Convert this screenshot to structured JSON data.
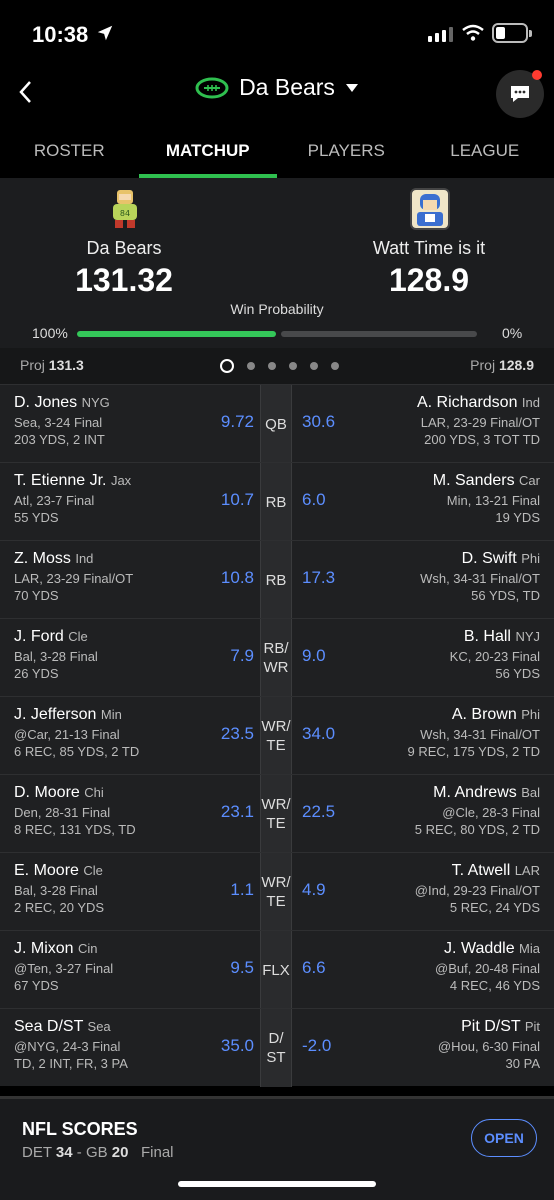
{
  "status": {
    "time": "10:38"
  },
  "header": {
    "title": "Da Bears"
  },
  "tabs": [
    {
      "label": "ROSTER"
    },
    {
      "label": "MATCHUP"
    },
    {
      "label": "PLAYERS"
    },
    {
      "label": "LEAGUE"
    }
  ],
  "matchup": {
    "left": {
      "name": "Da Bears",
      "score": "131.32",
      "win_pct": "100%",
      "proj": "131.3"
    },
    "right": {
      "name": "Watt Time is it",
      "score": "128.9",
      "win_pct": "0%",
      "proj": "128.9"
    },
    "win_label": "Win Probability",
    "win_fraction_left": 1.0,
    "proj_label": "Proj",
    "pager": {
      "pages": 6,
      "current": 0
    }
  },
  "rows": [
    {
      "pos": "QB",
      "l": {
        "name": "D. Jones",
        "team": "NYG",
        "game": "Sea, 3-24 Final",
        "stats": "203 YDS, 2 INT",
        "pts": "9.72"
      },
      "r": {
        "name": "A. Richardson",
        "team": "Ind",
        "game": "LAR, 23-29 Final/OT",
        "stats": "200 YDS, 3 TOT TD",
        "pts": "30.6"
      }
    },
    {
      "pos": "RB",
      "l": {
        "name": "T. Etienne Jr.",
        "team": "Jax",
        "game": "Atl, 23-7 Final",
        "stats": "55 YDS",
        "pts": "10.7"
      },
      "r": {
        "name": "M. Sanders",
        "team": "Car",
        "game": "Min, 13-21 Final",
        "stats": "19 YDS",
        "pts": "6.0"
      }
    },
    {
      "pos": "RB",
      "l": {
        "name": "Z. Moss",
        "team": "Ind",
        "game": "LAR, 23-29 Final/OT",
        "stats": "70 YDS",
        "pts": "10.8"
      },
      "r": {
        "name": "D. Swift",
        "team": "Phi",
        "game": "Wsh, 34-31 Final/OT",
        "stats": "56 YDS, TD",
        "pts": "17.3"
      }
    },
    {
      "pos": "RB/\nWR",
      "l": {
        "name": "J. Ford",
        "team": "Cle",
        "game": "Bal, 3-28 Final",
        "stats": "26 YDS",
        "pts": "7.9"
      },
      "r": {
        "name": "B. Hall",
        "team": "NYJ",
        "game": "KC, 20-23 Final",
        "stats": "56 YDS",
        "pts": "9.0"
      }
    },
    {
      "pos": "WR/\nTE",
      "l": {
        "name": "J. Jefferson",
        "team": "Min",
        "game": "@Car, 21-13 Final",
        "stats": "6 REC, 85 YDS, 2 TD",
        "pts": "23.5"
      },
      "r": {
        "name": "A. Brown",
        "team": "Phi",
        "game": "Wsh, 34-31 Final/OT",
        "stats": "9 REC, 175 YDS, 2 TD",
        "pts": "34.0"
      }
    },
    {
      "pos": "WR/\nTE",
      "l": {
        "name": "D. Moore",
        "team": "Chi",
        "game": "Den, 28-31 Final",
        "stats": "8 REC, 131 YDS, TD",
        "pts": "23.1"
      },
      "r": {
        "name": "M. Andrews",
        "team": "Bal",
        "game": "@Cle, 28-3 Final",
        "stats": "5 REC, 80 YDS, 2 TD",
        "pts": "22.5"
      }
    },
    {
      "pos": "WR/\nTE",
      "l": {
        "name": "E. Moore",
        "team": "Cle",
        "game": "Bal, 3-28 Final",
        "stats": "2 REC, 20 YDS",
        "pts": "1.1"
      },
      "r": {
        "name": "T. Atwell",
        "team": "LAR",
        "game": "@Ind, 29-23 Final/OT",
        "stats": "5 REC, 24 YDS",
        "pts": "4.9"
      }
    },
    {
      "pos": "FLX",
      "l": {
        "name": "J. Mixon",
        "team": "Cin",
        "game": "@Ten, 3-27 Final",
        "stats": "67 YDS",
        "pts": "9.5"
      },
      "r": {
        "name": "J. Waddle",
        "team": "Mia",
        "game": "@Buf, 20-48 Final",
        "stats": "4 REC, 46 YDS",
        "pts": "6.6"
      }
    },
    {
      "pos": "D/\nST",
      "l": {
        "name": "Sea D/ST",
        "team": "Sea",
        "game": "@NYG, 24-3 Final",
        "stats": "TD, 2 INT, FR, 3 PA",
        "pts": "35.0"
      },
      "r": {
        "name": "Pit D/ST",
        "team": "Pit",
        "game": "@Hou, 6-30 Final",
        "stats": "30 PA",
        "pts": "-2.0"
      }
    }
  ],
  "scores": {
    "title": "NFL SCORES",
    "team1": "DET",
    "score1": "34",
    "team2": "GB",
    "score2": "20",
    "state": "Final",
    "open_label": "OPEN"
  },
  "colors": {
    "accent": "#2fbf4f",
    "points": "#5c8eff",
    "win_bar": "#34c759"
  }
}
